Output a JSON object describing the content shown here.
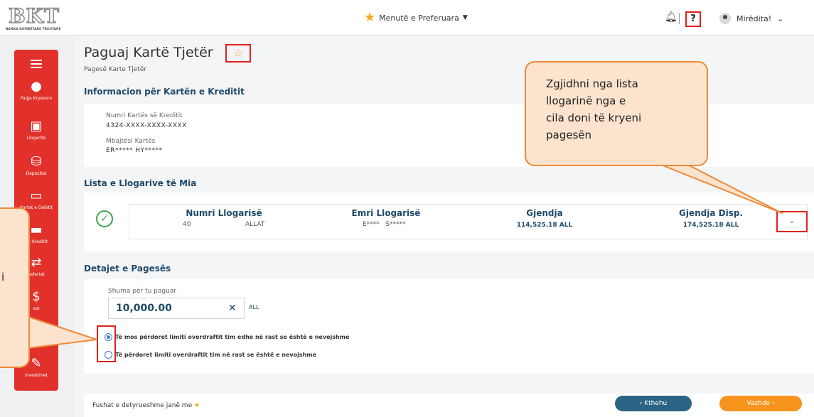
{
  "header": {
    "logo_text": "BKT",
    "logo_subtitle": "BANKA KOMBËTARE TREGTARE",
    "favorites_label": "Menutë e Preferuara",
    "help_label": "?",
    "greeting": "Mirëdita!"
  },
  "sidebar": {
    "items": [
      {
        "label": "Faqja Kryesore",
        "icon": "home-icon"
      },
      {
        "label": "Llogaritë",
        "icon": "accounts-icon"
      },
      {
        "label": "Depozitat",
        "icon": "deposit-icon"
      },
      {
        "label": "Kartat e Debitit",
        "icon": "debit-card-icon"
      },
      {
        "label": "t e Kreditit",
        "icon": "credit-card-icon"
      },
      {
        "label": "nsfertat",
        "icon": "transfers-icon"
      },
      {
        "label": "sat",
        "icon": "payments-icon"
      },
      {
        "label": "Investimet",
        "icon": "investments-icon"
      }
    ]
  },
  "page": {
    "title": "Paguaj Kartë Tjetër",
    "subtitle": "Pagesë Karte Tjetër"
  },
  "card_info": {
    "heading": "Informacion për Kartën e Kreditit",
    "number_label": "Numri Kartës së Kreditit",
    "number_value": "4324-XXXX-XXXX-XXXX",
    "holder_label": "Mbajtësi Kartës",
    "holder_value": "ER***** HY*****"
  },
  "accounts": {
    "heading": "Lista e Llogarive të Mia",
    "columns": [
      "Numri Llogarisë",
      "Emri Llogarisë",
      "Gjendja",
      "Gjendja Disp."
    ],
    "row": {
      "number_prefix": "40",
      "number_type": "ALLAT",
      "name": "E****   S*****",
      "balance": "114,525.18 ALL",
      "available": "174,525.18 ALL"
    }
  },
  "payment": {
    "heading": "Detajet e Pagesës",
    "amount_label": "Shuma për tu paguar",
    "amount_value": "10,000.00",
    "currency": "ALL",
    "clear_label": "✕",
    "options": [
      {
        "label": "Të mos përdoret limiti overdraftit tim edhe në rast se është e nevojshme",
        "selected": true
      },
      {
        "label": "Të përdoret limiti overdraftit tim në rast se është e nevojshme",
        "selected": false
      }
    ]
  },
  "footer": {
    "required_text": "Fushat e detyrueshme janë me",
    "required_mark": "★",
    "back_label": "‹ Kthehu",
    "next_label": "Vazhdo ›"
  },
  "callouts": {
    "right": [
      "Zgjidhni nga lista",
      "llogarinë nga e",
      "cila doni të kryeni",
      "pagesën"
    ],
    "left_fragment": "i"
  },
  "colors": {
    "brand_red": "#e2312b",
    "navy": "#1f4a69",
    "orange": "#f7941d",
    "back_button": "#2b6384",
    "highlight": "#e0221c",
    "callout_fill": "#fbe3cd",
    "callout_border": "#ec8a3a"
  }
}
